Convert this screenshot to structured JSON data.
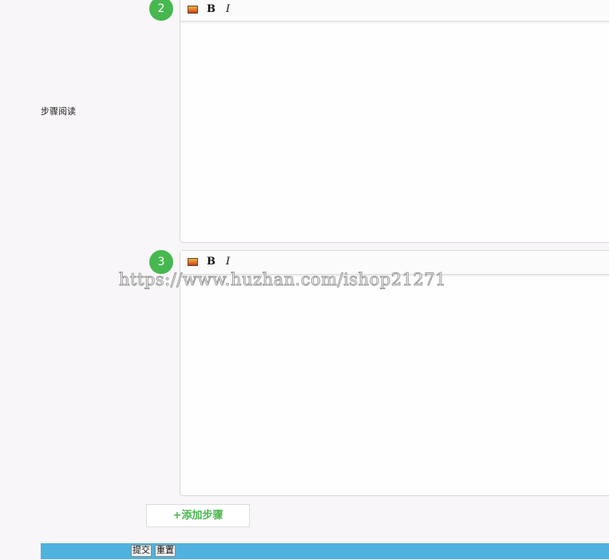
{
  "section_label": "步骤阅读",
  "steps": [
    {
      "number": "2",
      "toolbar": {
        "image_icon": "image-icon",
        "bold_label": "B",
        "italic_label": "I"
      }
    },
    {
      "number": "3",
      "toolbar": {
        "image_icon": "image-icon",
        "bold_label": "B",
        "italic_label": "I"
      }
    }
  ],
  "watermark": "https://www.huzhan.com/ishop21271",
  "add_step_label": "+添加步骤",
  "footer": {
    "submit_label": "提交",
    "reset_label": "重置"
  },
  "colors": {
    "step_badge": "#47b74f",
    "footer_bar": "#50b2dc",
    "add_step_text": "#47b74f"
  }
}
